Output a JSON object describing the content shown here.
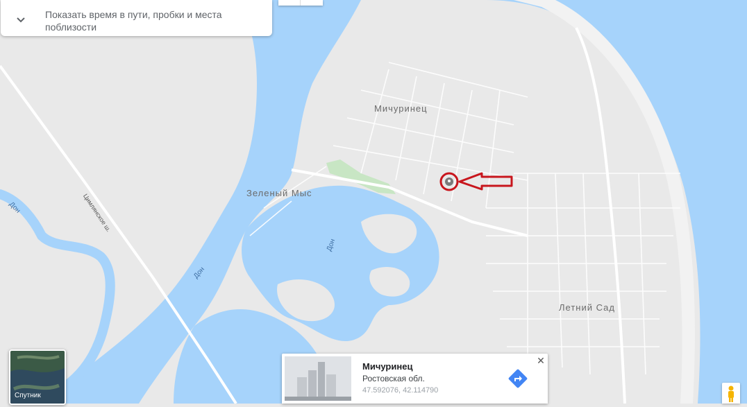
{
  "header": {
    "expand_text": "Показать время в пути, пробки и места поблизости"
  },
  "map": {
    "labels": {
      "michurinets": "Мичуринец",
      "zeleny_mys": "Зеленый Мыс",
      "letny_sad": "Летний Сад",
      "don_left": "Дон",
      "don_river": "Дон",
      "don_lake": "Дон",
      "road": "Цимлянское ш."
    },
    "water_color": "#a6d3fb",
    "land_color": "#e9e9e9",
    "highlight_color": "#c8161d"
  },
  "satellite": {
    "label": "Спутник"
  },
  "place_card": {
    "title": "Мичуринец",
    "subtitle": "Ростовская обл.",
    "coordinates": "47.592076, 42.114790",
    "accent": "#4285f4"
  }
}
